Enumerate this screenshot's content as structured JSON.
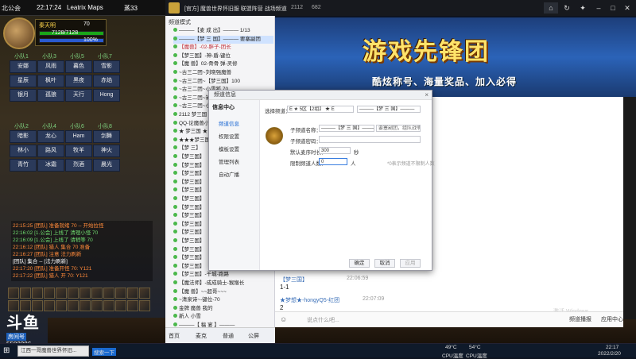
{
  "game": {
    "top_left_text": "北公会",
    "clock": "22:17:24",
    "map_label": "Leatrix Maps",
    "coords_text": "蒸33",
    "player_name": "秦天明",
    "level": "70",
    "hp_text": "7128/7128",
    "mp_text": "100%",
    "raid_headers": [
      "小队1",
      "小队3",
      "小队5",
      "小队7",
      "小队2",
      "小队4",
      "小队6",
      "小队8"
    ],
    "raid_names": [
      "安娜",
      "风雨",
      "暮色",
      "雪影",
      "星辰",
      "枫叶",
      "黑夜",
      "赤焰",
      "银月",
      "孤狼",
      "天行",
      "Hong",
      "暗影",
      "龙心",
      "Ham",
      "剑舞",
      "林小",
      "路风",
      "牧羊",
      "神火",
      "青竹",
      "冰霜",
      "烈酒",
      "晨光"
    ],
    "chat_lines": [
      "22:15:25 [团队] 准备就绪 70 -- 开始拉怪",
      "22:16:02 [1.公会] 上线了 清理小怪 70",
      "22:16:09 [1.公会] 上线了 请稍等 70",
      "22:16:12 [团队] 猎人 集合 70 准备",
      "22:16:27 [团队] 注意 法力刷新",
      "[团队] 集合 -- [法力刷新]",
      "22:17:20 [团队] 准备开怪 70: Y121",
      "22:17:22 [团队] 猎人 开 70: Y121"
    ],
    "douyu_logo": "斗鱼",
    "douyu_sub": "房间号",
    "room_number": "5582286"
  },
  "yy": {
    "window_title": "[官方] 魔兽世界怀旧服 联盟阵营 战场频道",
    "online_count": "2112",
    "members_count": "682",
    "left_tab": "频道模式",
    "tree_items": [
      {
        "label": "———【麦 成 出】——— 1/13",
        "cls": ""
      },
      {
        "label": "———【梦 三 国】——— 要塞副团",
        "cls": "sel"
      },
      {
        "label": "【魔兽】-02-胖子-团长",
        "cls": "red"
      },
      {
        "label": "【梦三国】-神-盾-键位",
        "cls": ""
      },
      {
        "label": "【魔 兽】02-骨骨 弹-灵修",
        "cls": ""
      },
      {
        "label": "~古三二团~刘晓强魔兽",
        "cls": ""
      },
      {
        "label": "~古三二团~【梦三国】100",
        "cls": ""
      },
      {
        "label": "~古三二团~小雪狐 70",
        "cls": ""
      },
      {
        "label": "~古三二团~钟小牛 70",
        "cls": ""
      },
      {
        "label": "~古三二团~小乐家族",
        "cls": ""
      },
      {
        "label": "2112 梦三国",
        "cls": ""
      },
      {
        "label": "QQ-论魔兽小强",
        "cls": ""
      },
      {
        "label": "★ 梦三国 ★",
        "cls": ""
      },
      {
        "label": "★★★梦三国",
        "cls": ""
      },
      {
        "label": "【梦 三】",
        "cls": ""
      },
      {
        "label": "【梦三国】",
        "cls": ""
      },
      {
        "label": "【梦三国】",
        "cls": ""
      },
      {
        "label": "【梦三国】",
        "cls": ""
      },
      {
        "label": "【梦三国】",
        "cls": ""
      },
      {
        "label": "【梦三国】",
        "cls": ""
      },
      {
        "label": "【梦三国】",
        "cls": ""
      },
      {
        "label": "【梦三国】",
        "cls": ""
      },
      {
        "label": "【梦三国】",
        "cls": ""
      },
      {
        "label": "【梦三国】",
        "cls": ""
      },
      {
        "label": "【梦三国】",
        "cls": ""
      },
      {
        "label": "【梦三国】",
        "cls": ""
      },
      {
        "label": "【梦三国】",
        "cls": ""
      },
      {
        "label": "【梦三国】",
        "cls": ""
      },
      {
        "label": "【梦三国】",
        "cls": ""
      },
      {
        "label": "【梦三国】-千城-跑路",
        "cls": ""
      },
      {
        "label": "【魔法师】-成成骑士-猴猴长",
        "cls": ""
      },
      {
        "label": "【魔 兽】~~超哥~~~",
        "cls": ""
      },
      {
        "label": "~清泉诗~-键位-70",
        "cls": ""
      },
      {
        "label": "金牌 魔兽 我的",
        "cls": ""
      },
      {
        "label": "新人 小雪",
        "cls": ""
      },
      {
        "label": "———【 稿 宴 】———",
        "cls": ""
      }
    ],
    "banner_title": "游戏先锋团",
    "banner_sub": "酷炫称号、海量奖品、加入必得",
    "chat": [
      {
        "name": "【梦三国】",
        "id": "1-1",
        "time": "22:06:59"
      },
      {
        "text": "1-1"
      },
      {
        "name": "★梦想★-hongyQ5-红团",
        "time": "22:07:09"
      },
      {
        "text": "2"
      }
    ],
    "input_placeholder": "说点什么吧...",
    "foot_items": [
      "首页",
      "麦克",
      "普通",
      "公屏"
    ],
    "foot_right": [
      "频道播报",
      "应用中心"
    ],
    "activate_text": "激活 Windows"
  },
  "dialog": {
    "title": "频道信息",
    "close": "×",
    "side_head": "信息中心",
    "side_items": [
      "频道信息",
      "权限设置",
      "模板设置",
      "管理列表",
      "自动广播"
    ],
    "select_label": "选择频道：",
    "select_value": "E ★ 5区【2组】 ★ E",
    "select_value2": "———【梦 三 国】———",
    "fields": [
      {
        "label": "子频道名称：",
        "value": "———【梦 三 国】———"
      },
      {
        "label": "子频道密码：",
        "value": ""
      },
      {
        "label": "默认麦序时长：",
        "value": "300"
      },
      {
        "label": "限制频道人数：",
        "value": "0"
      }
    ],
    "side_hint1": "要塞副团，组队战争分门",
    "unit_seconds": "秒",
    "unit_people": "人",
    "limit_hint": "*0表示频道不限制人数",
    "btn_ok": "确定",
    "btn_cancel": "取消",
    "btn_apply": "应用"
  },
  "taskbar": {
    "search_text": "江西一哥魔兽世界怀旧...",
    "search_button": "搜索一下",
    "temp": "49°C",
    "cpu_label": "CPU温度",
    "temp2": "54°C",
    "cpu_label2": "CPU温度",
    "time": "22:17",
    "date": "2022/2/20"
  }
}
